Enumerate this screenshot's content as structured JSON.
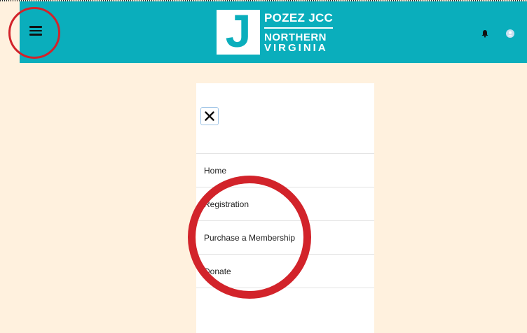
{
  "header": {
    "menu_icon": "hamburger-menu-icon",
    "logo": {
      "letter": "J",
      "line1": "POZEZ JCC",
      "line2": "NORTHERN",
      "line3": "VIRGINIA"
    },
    "notification_icon": "bell-icon",
    "account_icon": "user-avatar-icon",
    "background_color": "#0aaebc"
  },
  "menu": {
    "close_icon": "close-x-icon",
    "items": [
      {
        "label": "Home"
      },
      {
        "label": "Registration"
      },
      {
        "label": "Purchase a Membership"
      },
      {
        "label": "Donate"
      }
    ]
  },
  "annotations": {
    "highlight_color": "#d2232a"
  },
  "page": {
    "background_color": "#fff1de"
  }
}
